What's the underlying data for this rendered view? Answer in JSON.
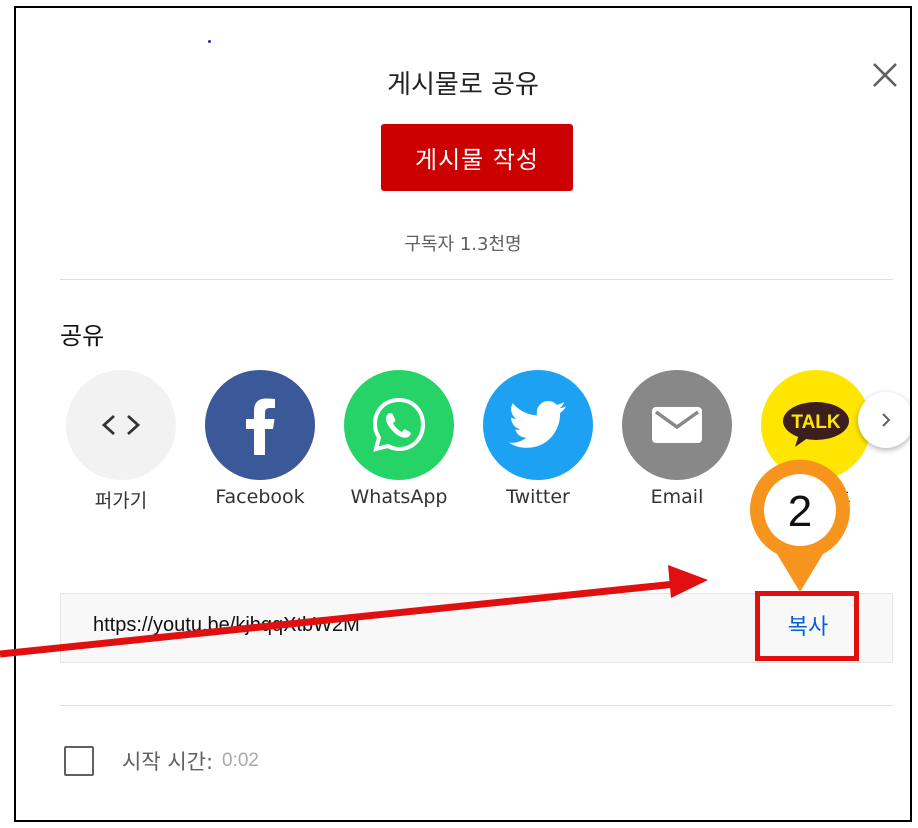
{
  "dialog": {
    "title": "게시물로 공유",
    "post_button": "게시물 작성",
    "subscribers": "구독자 1.3천명",
    "share_label": "공유",
    "share_items": [
      {
        "label": "퍼가기",
        "icon": "embed-icon",
        "color": "#f2f2f2"
      },
      {
        "label": "Facebook",
        "icon": "facebook-icon",
        "color": "#3b5998"
      },
      {
        "label": "WhatsApp",
        "icon": "whatsapp-icon",
        "color": "#25d366"
      },
      {
        "label": "Twitter",
        "icon": "twitter-icon",
        "color": "#1da1f2"
      },
      {
        "label": "Email",
        "icon": "email-icon",
        "color": "#888888"
      },
      {
        "label": "카카오톡",
        "icon": "kakaotalk-icon",
        "color": "#ffe600"
      }
    ],
    "url": "https://youtu.be/kjbqqXtbW2M",
    "copy_button": "복사",
    "start_time_label": "시작 시간:",
    "start_time_value": "0:02"
  },
  "annotation": {
    "step_number": "2",
    "pin_color": "#f7941d",
    "highlight_color": "#e01010",
    "arrow_color": "#e01010"
  }
}
